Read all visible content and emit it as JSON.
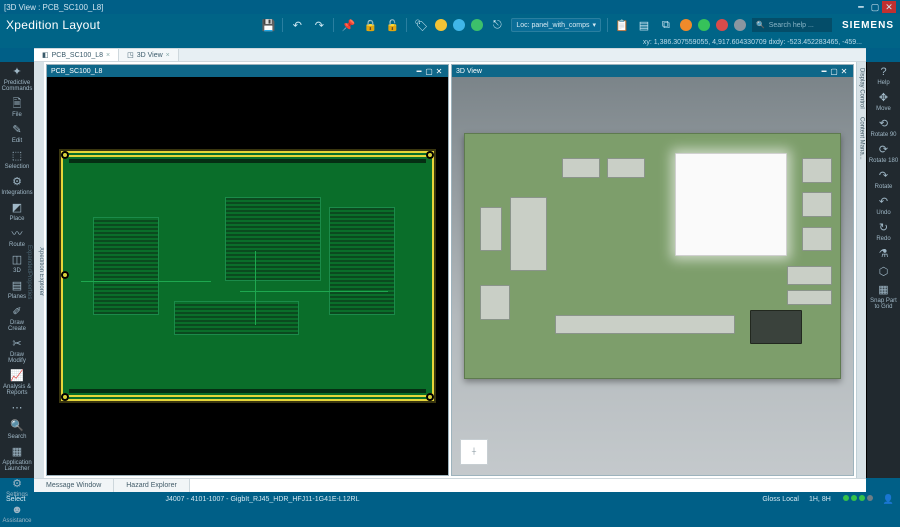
{
  "window": {
    "title": "[3D View : PCB_SC100_L8]"
  },
  "app": {
    "name": "Xpedition Layout",
    "brand": "SIEMENS"
  },
  "ribbon": {
    "combo_label": "Loc: panel_with_comps",
    "search_placeholder": "Search help ...",
    "coords": "xy: 1,386.307559055, 4,917.604330709  dxdy: -523.452283465, -459..."
  },
  "doc_tabs": [
    {
      "icon": "◧",
      "label": "PCB_SC100_L8"
    },
    {
      "icon": "◳",
      "label": "3D View"
    }
  ],
  "left_sidebar": [
    {
      "icon": "✦",
      "label": "Predictive Commands"
    },
    {
      "icon": "🗎",
      "label": "File"
    },
    {
      "icon": "✎",
      "label": "Edit"
    },
    {
      "icon": "⬚",
      "label": "Selection"
    },
    {
      "icon": "⚙",
      "label": "Integrations"
    },
    {
      "icon": "◩",
      "label": "Place"
    },
    {
      "icon": "〰",
      "label": "Route"
    },
    {
      "icon": "◫",
      "label": "3D"
    },
    {
      "icon": "▤",
      "label": "Planes"
    },
    {
      "icon": "✐",
      "label": "Draw Create"
    },
    {
      "icon": "✂",
      "label": "Draw Modify"
    },
    {
      "icon": "📈",
      "label": "Analysis & Reports"
    },
    {
      "icon": "⋯",
      "label": ""
    },
    {
      "icon": "🔍",
      "label": "Search"
    },
    {
      "icon": "▦",
      "label": "Application Launcher"
    },
    {
      "icon": "⚙",
      "label": "Settings"
    },
    {
      "icon": "☻",
      "label": "Assistance"
    }
  ],
  "right_sidebar": [
    {
      "icon": "?",
      "label": "Help"
    },
    {
      "icon": "✥",
      "label": "Move"
    },
    {
      "icon": "⟲",
      "label": "Rotate 90"
    },
    {
      "icon": "⟳",
      "label": "Rotate 180"
    },
    {
      "icon": "↷",
      "label": "Rotate"
    },
    {
      "icon": "↶",
      "label": "Undo"
    },
    {
      "icon": "↻",
      "label": "Redo"
    },
    {
      "icon": "⚗",
      "label": ""
    },
    {
      "icon": "⬡",
      "label": ""
    },
    {
      "icon": "▦",
      "label": "Snap Part to Grid"
    }
  ],
  "left_rail_tabs": [
    "Xpedition Explorer",
    "ExpandedProperties"
  ],
  "right_rail_tabs": [
    "Display Control",
    "Content Mana..."
  ],
  "panes": {
    "left": {
      "title": "PCB_SC100_L8"
    },
    "right": {
      "title": "3D View"
    }
  },
  "bottom_tabs": [
    "Message Window",
    "Hazard Explorer"
  ],
  "status": {
    "left": "Select",
    "component": "J4007 - 4101-1007 - GigbIt_RJ45_HDR_HFJ11-1G41E-L12RL",
    "gloss": "Gloss Local",
    "layers": "1H, 8H",
    "leds": [
      "#35c24a",
      "#35c24a",
      "#35c24a",
      "#6d7d85"
    ]
  }
}
